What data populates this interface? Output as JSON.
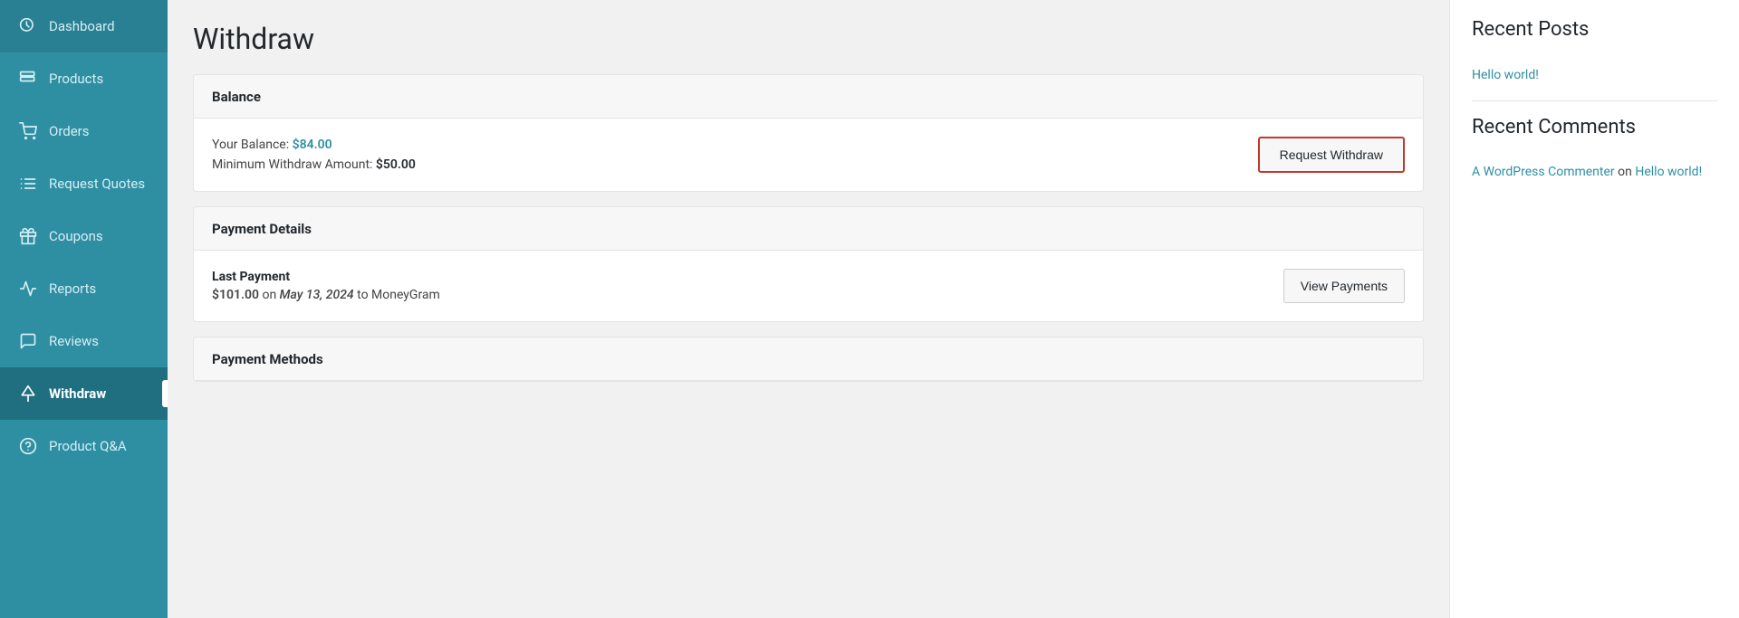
{
  "sidebar": {
    "items": [
      {
        "id": "dashboard",
        "label": "Dashboard",
        "icon": "dashboard-icon",
        "active": false
      },
      {
        "id": "products",
        "label": "Products",
        "icon": "products-icon",
        "active": false
      },
      {
        "id": "orders",
        "label": "Orders",
        "icon": "orders-icon",
        "active": false
      },
      {
        "id": "request-quotes",
        "label": "Request Quotes",
        "icon": "quotes-icon",
        "active": false
      },
      {
        "id": "coupons",
        "label": "Coupons",
        "icon": "coupons-icon",
        "active": false
      },
      {
        "id": "reports",
        "label": "Reports",
        "icon": "reports-icon",
        "active": false
      },
      {
        "id": "reviews",
        "label": "Reviews",
        "icon": "reviews-icon",
        "active": false
      },
      {
        "id": "withdraw",
        "label": "Withdraw",
        "icon": "withdraw-icon",
        "active": true
      },
      {
        "id": "product-qa",
        "label": "Product Q&A",
        "icon": "qa-icon",
        "active": false
      }
    ]
  },
  "page": {
    "title": "Withdraw"
  },
  "balance_card": {
    "header": "Balance",
    "balance_label": "Your Balance: ",
    "balance_value": "$84.00",
    "min_label": "Minimum Withdraw Amount: ",
    "min_value": "$50.00",
    "request_button": "Request Withdraw"
  },
  "payment_details_card": {
    "header": "Payment Details",
    "last_payment_label": "Last Payment",
    "payment_amount": "$101.00",
    "payment_preposition": "on",
    "payment_date": "May 13, 2024",
    "payment_to": "to MoneyGram",
    "view_button": "View Payments"
  },
  "payment_methods_card": {
    "header": "Payment Methods"
  },
  "right_sidebar": {
    "recent_posts_title": "Recent Posts",
    "posts": [
      {
        "label": "Hello world!",
        "href": "#"
      }
    ],
    "recent_comments_title": "Recent Comments",
    "comments": [
      {
        "commenter": "A WordPress Commenter",
        "commenter_href": "#",
        "preposition": "on",
        "post": "Hello world!",
        "post_href": "#"
      }
    ]
  }
}
